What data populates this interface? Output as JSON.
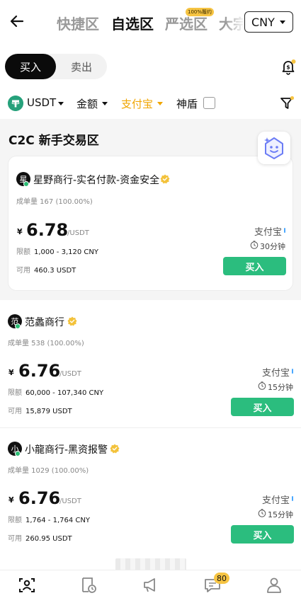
{
  "header": {
    "tabs": [
      {
        "label": "快捷区",
        "active": false
      },
      {
        "label": "自选区",
        "active": true
      },
      {
        "label": "严选区",
        "active": false,
        "badge": "100%履约"
      },
      {
        "label": "大宗",
        "active": false
      }
    ],
    "currency": "CNY"
  },
  "trade_toggle": {
    "buy": "买入",
    "sell": "卖出",
    "selected": "buy"
  },
  "filters": {
    "asset": "USDT",
    "amount": "金额",
    "payment": "支付宝",
    "shield": "神盾",
    "shield_checked": false
  },
  "section": {
    "title": "C2C 新手交易区"
  },
  "merchants": [
    {
      "avatar": "星",
      "name": "星野商行-实名付款-资金安全",
      "stats": "成单量 167 (100.00%)",
      "currency_symbol": "¥",
      "price": "6.78",
      "unit": "/USDT",
      "limit_label": "限额",
      "limit": "1,000 - 3,120 CNY",
      "avail_label": "可用",
      "available": "460.3 USDT",
      "payment": "支付宝",
      "time": "30分钟",
      "action": "买入"
    },
    {
      "avatar": "范",
      "name": "范蠡商行",
      "stats": "成单量 538 (100.00%)",
      "currency_symbol": "¥",
      "price": "6.76",
      "unit": "/USDT",
      "limit_label": "限额",
      "limit": "60,000 - 107,340 CNY",
      "avail_label": "可用",
      "available": "15,879 USDT",
      "payment": "支付宝",
      "time": "15分钟",
      "action": "买入"
    },
    {
      "avatar": "小",
      "name": "小龍商行-黑资报警",
      "stats": "成单量 1029 (100.00%)",
      "currency_symbol": "¥",
      "price": "6.76",
      "unit": "/USDT",
      "limit_label": "限额",
      "limit": "1,764 - 1,764 CNY",
      "avail_label": "可用",
      "available": "260.95 USDT",
      "payment": "支付宝",
      "time": "15分钟",
      "action": "买入"
    }
  ],
  "bottom_nav": {
    "icons": [
      "trade-icon",
      "orders-icon",
      "announcement-icon",
      "messages-icon",
      "profile-icon"
    ],
    "messages_badge": "80"
  },
  "colors": {
    "buy_green": "#2bbd7e",
    "accent_gold": "#f0a500",
    "online_green": "#2bbd74"
  }
}
